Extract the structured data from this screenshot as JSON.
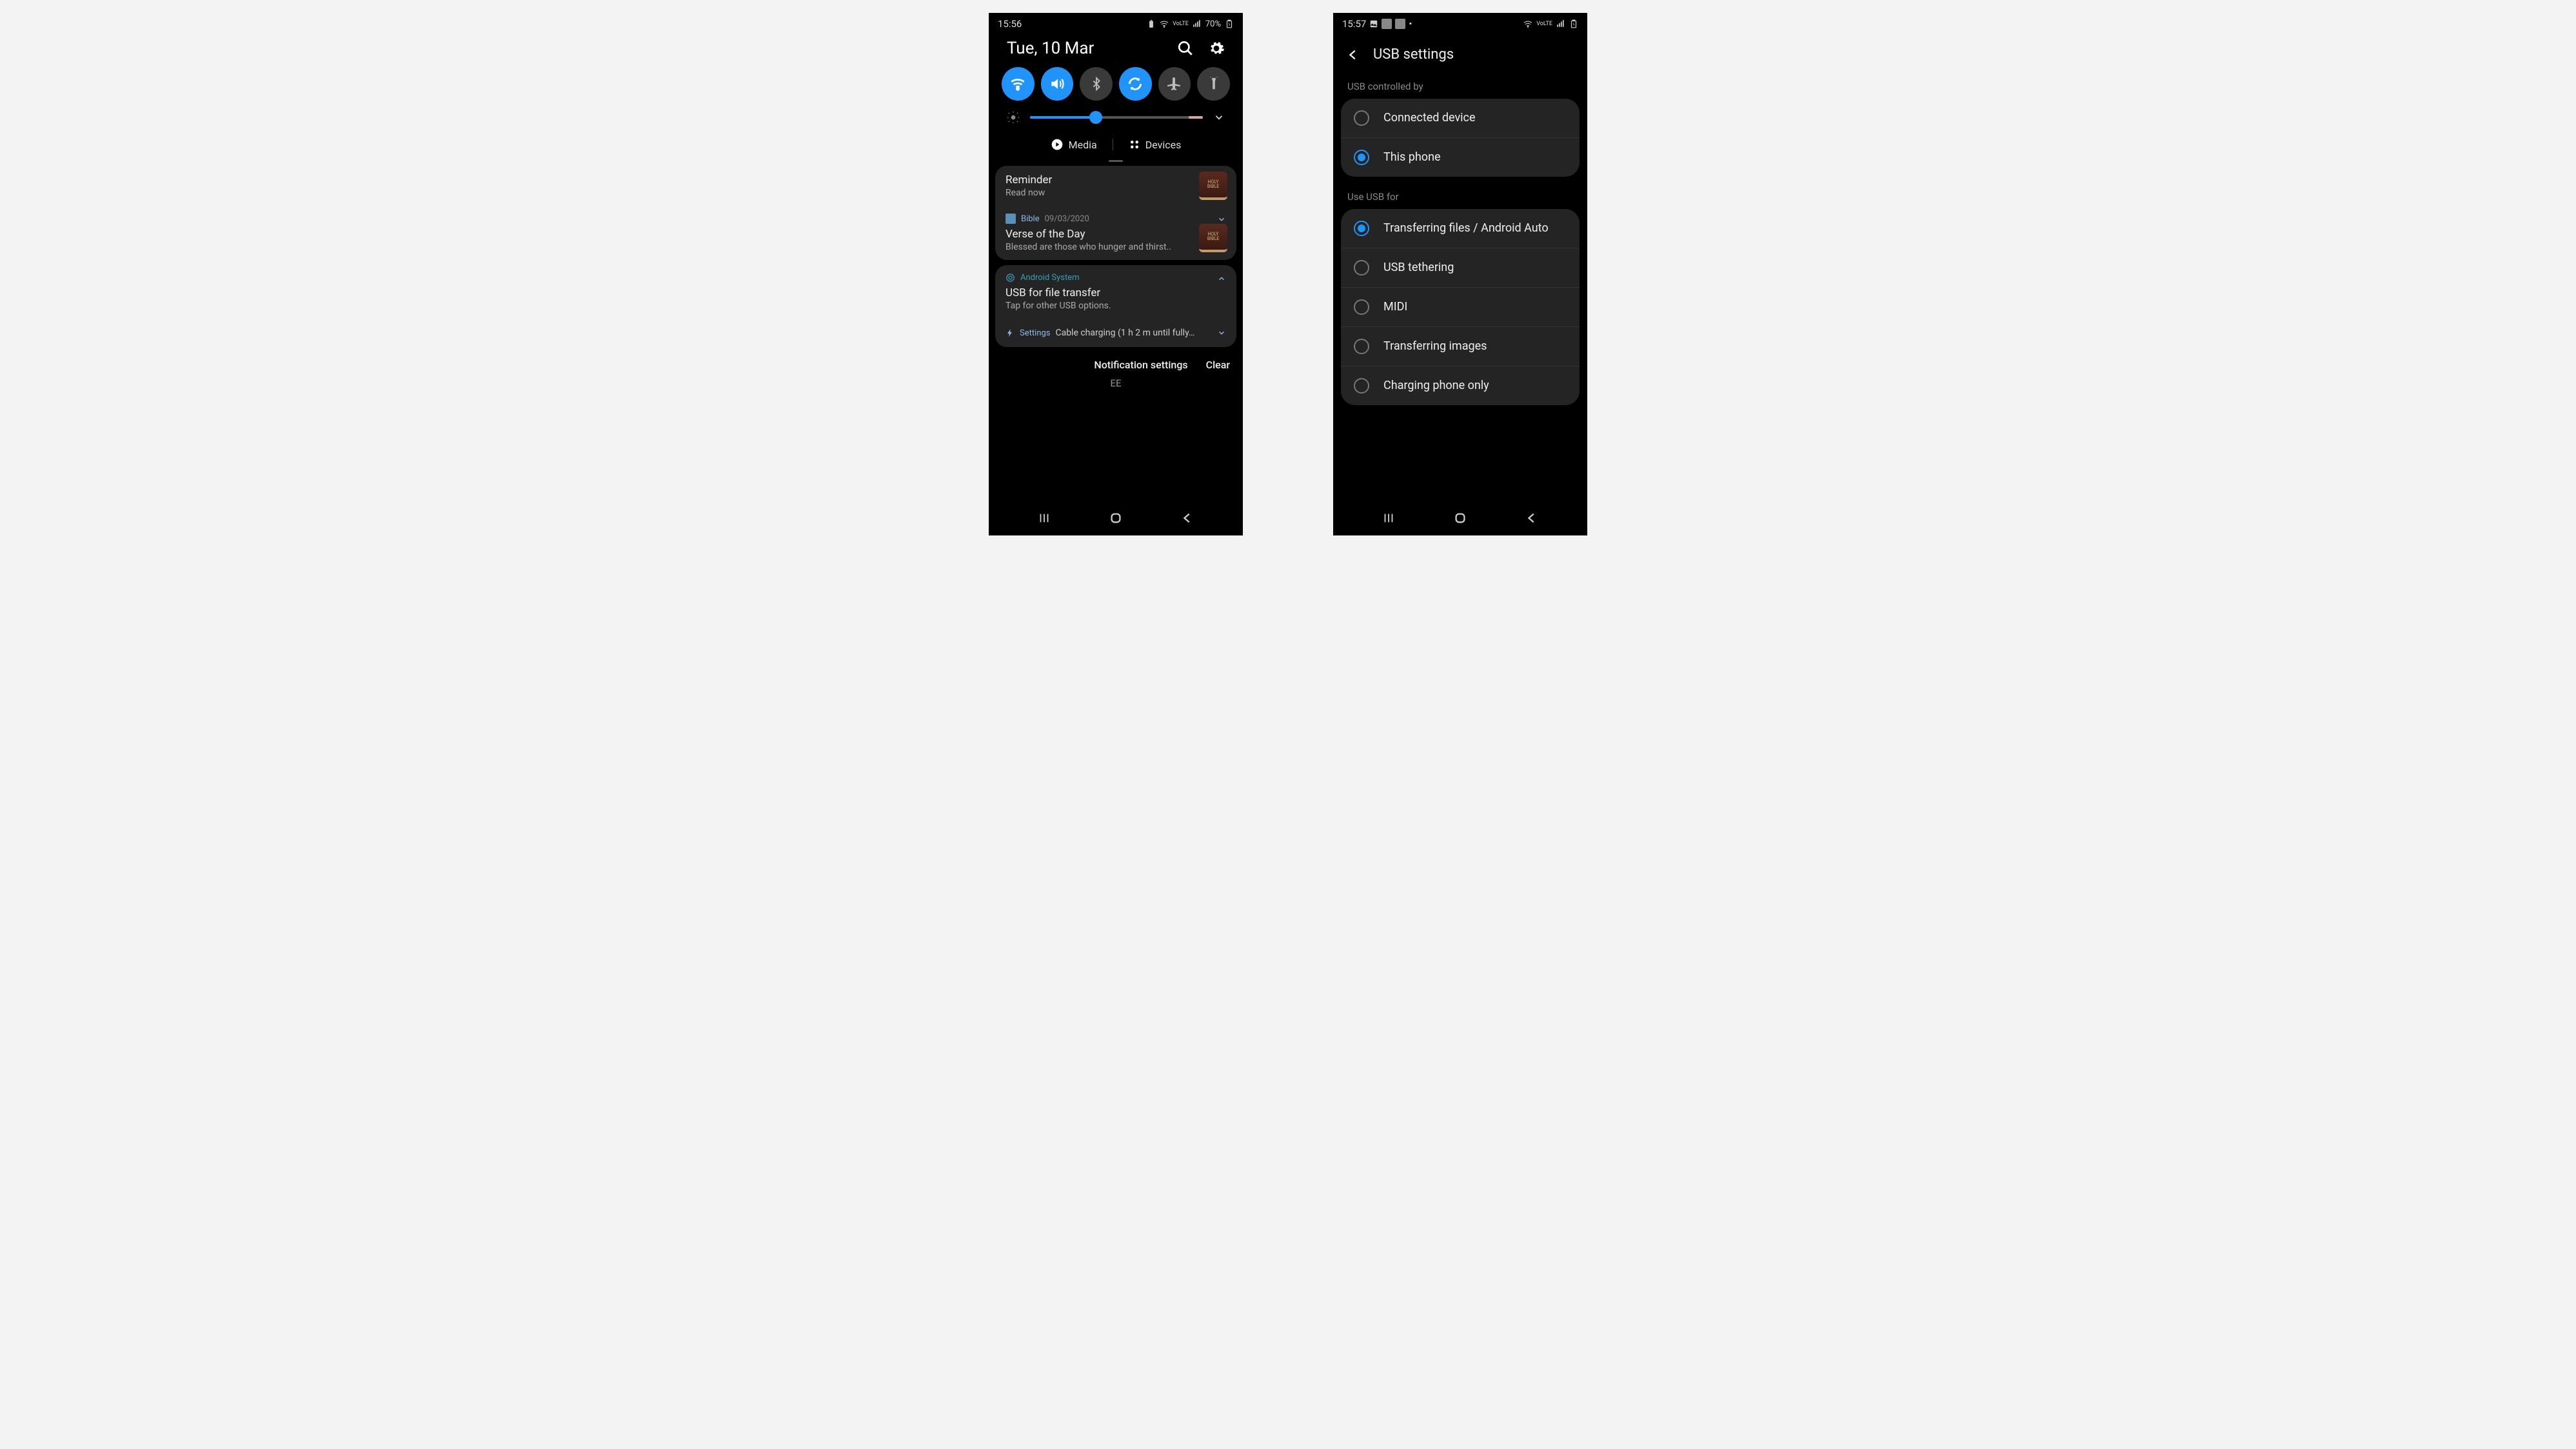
{
  "phone1": {
    "status": {
      "time": "15:56",
      "battery_text": "70%",
      "net": "VoLTE"
    },
    "quick": {
      "date": "Tue, 10 Mar",
      "toggles": [
        {
          "name": "wifi",
          "on": true
        },
        {
          "name": "sound",
          "on": true
        },
        {
          "name": "bluetooth",
          "on": false
        },
        {
          "name": "rotate",
          "on": true
        },
        {
          "name": "airplane",
          "on": false
        },
        {
          "name": "flashlight",
          "on": false
        }
      ],
      "brightness_pct": 38,
      "media_label": "Media",
      "devices_label": "Devices"
    },
    "notifications": [
      {
        "title": "Reminder",
        "body": "Read now",
        "thumb": "bible"
      },
      {
        "app": "Bible",
        "date": "09/03/2020",
        "title": "Verse of the Day",
        "body": "Blessed are those who hunger and thirst..",
        "thumb": "bible",
        "chevron": true
      },
      {
        "app": "Android System",
        "title": "USB for file transfer",
        "body": "Tap for other USB options.",
        "chevron_up": true,
        "app_color": "teal"
      },
      {
        "app": "Settings",
        "inline": "Cable charging (1 h 2 m until fully…",
        "chevron": true,
        "bolt": true
      }
    ],
    "actions": {
      "settings": "Notification settings",
      "clear": "Clear"
    },
    "carrier": "EE"
  },
  "phone2": {
    "status": {
      "time": "15:57"
    },
    "title": "USB settings",
    "section1_label": "USB controlled by",
    "section1_options": [
      {
        "label": "Connected device",
        "selected": false
      },
      {
        "label": "This phone",
        "selected": true
      }
    ],
    "section2_label": "Use USB for",
    "section2_options": [
      {
        "label": "Transferring files / Android Auto",
        "selected": true
      },
      {
        "label": "USB tethering",
        "selected": false
      },
      {
        "label": "MIDI",
        "selected": false
      },
      {
        "label": "Transferring images",
        "selected": false
      },
      {
        "label": "Charging phone only",
        "selected": false
      }
    ]
  }
}
